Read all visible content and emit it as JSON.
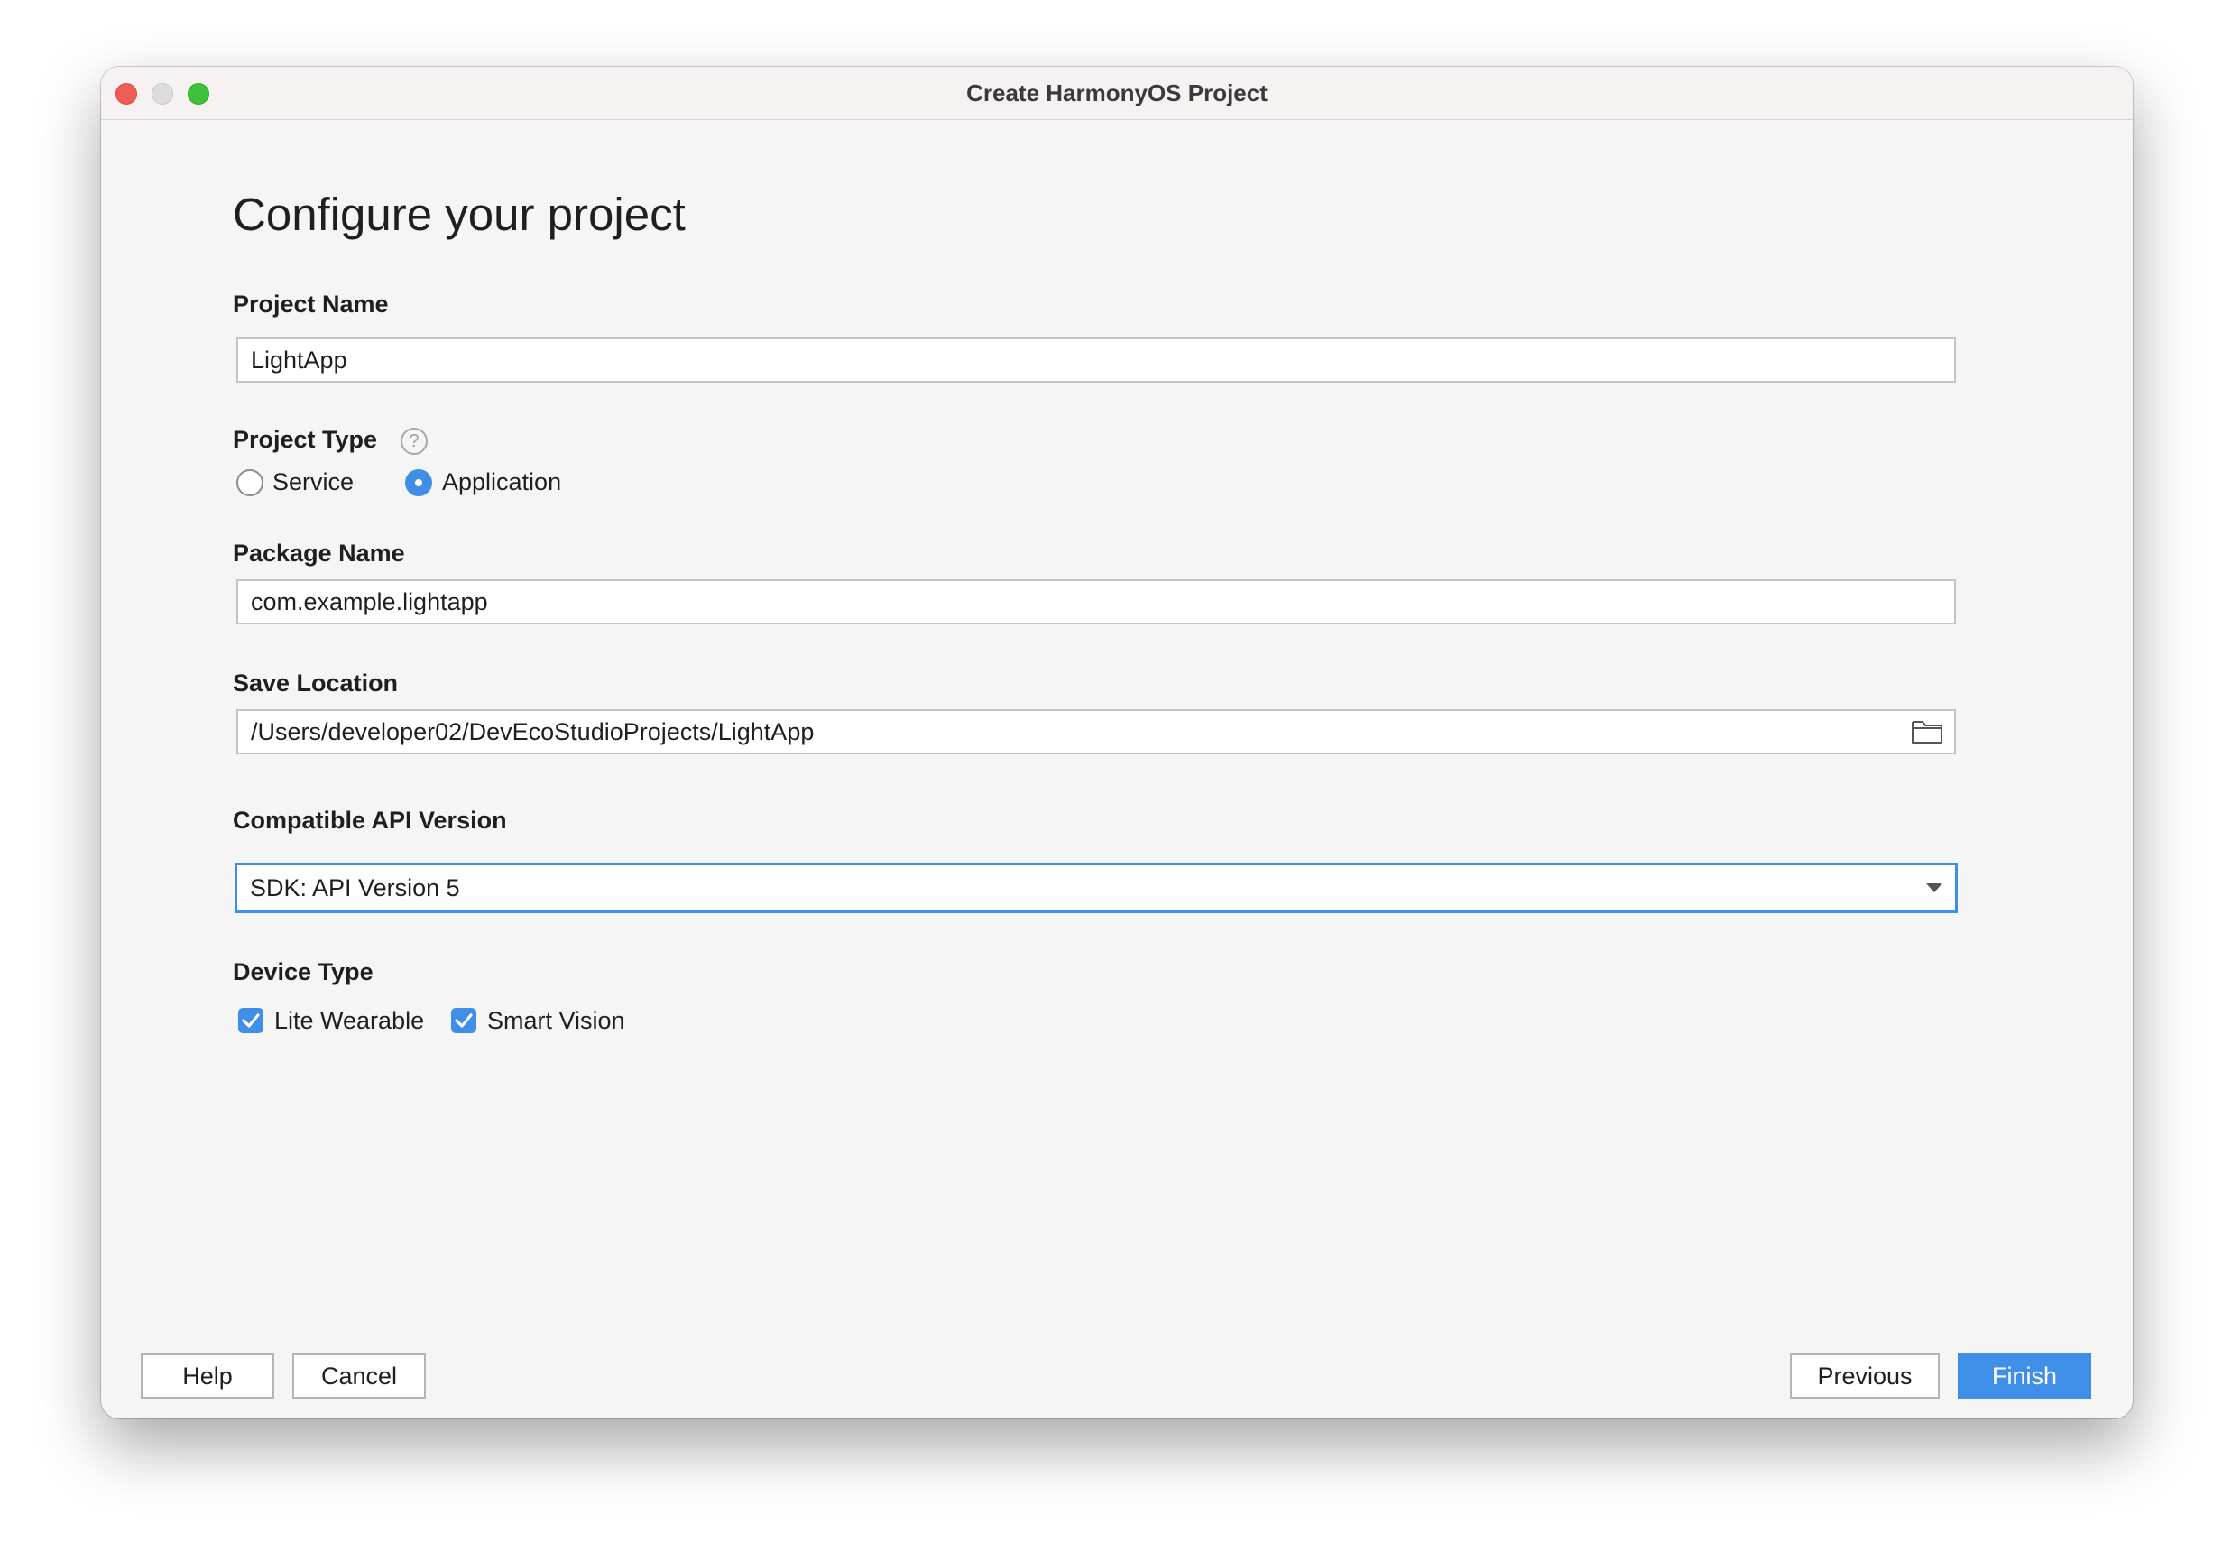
{
  "window": {
    "title": "Create HarmonyOS Project"
  },
  "page": {
    "title": "Configure your project"
  },
  "project_name": {
    "label": "Project Name",
    "value": "LightApp"
  },
  "project_type": {
    "label": "Project Type",
    "help_icon": "?",
    "options": [
      {
        "label": "Service",
        "selected": false
      },
      {
        "label": "Application",
        "selected": true
      }
    ]
  },
  "package_name": {
    "label": "Package Name",
    "value": "com.example.lightapp"
  },
  "save_location": {
    "label": "Save Location",
    "value": "/Users/developer02/DevEcoStudioProjects/LightApp",
    "browse_icon": "folder-icon"
  },
  "api_version": {
    "label": "Compatible API Version",
    "selected": "SDK: API Version 5"
  },
  "device_type": {
    "label": "Device Type",
    "options": [
      {
        "label": "Lite Wearable",
        "checked": true
      },
      {
        "label": "Smart Vision",
        "checked": true
      }
    ]
  },
  "buttons": {
    "help": "Help",
    "cancel": "Cancel",
    "previous": "Previous",
    "finish": "Finish"
  },
  "colors": {
    "accent": "#3f8fe8",
    "close": "#ee5e56",
    "minimize": "#dcdcdc",
    "maximize": "#3fc03a"
  }
}
